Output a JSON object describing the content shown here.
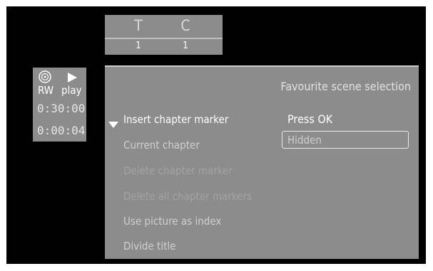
{
  "title_chapter": {
    "title_letter": "T",
    "chapter_letter": "C",
    "title_number": "1",
    "chapter_number": "1"
  },
  "status": {
    "disc_icon": "disc-icon",
    "play_icon": "play-triangle-icon",
    "disc_type": "RW",
    "mode": "play",
    "total_time": "0:30:00",
    "elapsed_time": "0:00:04"
  },
  "panel": {
    "title": "Favourite scene selection",
    "items": [
      {
        "label": "Insert chapter marker",
        "state": "selected"
      },
      {
        "label": "Current chapter",
        "state": "enabled"
      },
      {
        "label": "Delete chapter marker",
        "state": "disabled"
      },
      {
        "label": "Delete all chapter markers",
        "state": "disabled"
      },
      {
        "label": "Use picture as index",
        "state": "enabled"
      },
      {
        "label": "Divide title",
        "state": "enabled"
      }
    ],
    "action_text": "Press OK",
    "current_chapter_value": "Hidden"
  },
  "colors": {
    "background": "#000000",
    "panel": "#8c8c8c",
    "text_active": "#ffffff",
    "text_disabled": "#a3a3a3"
  }
}
